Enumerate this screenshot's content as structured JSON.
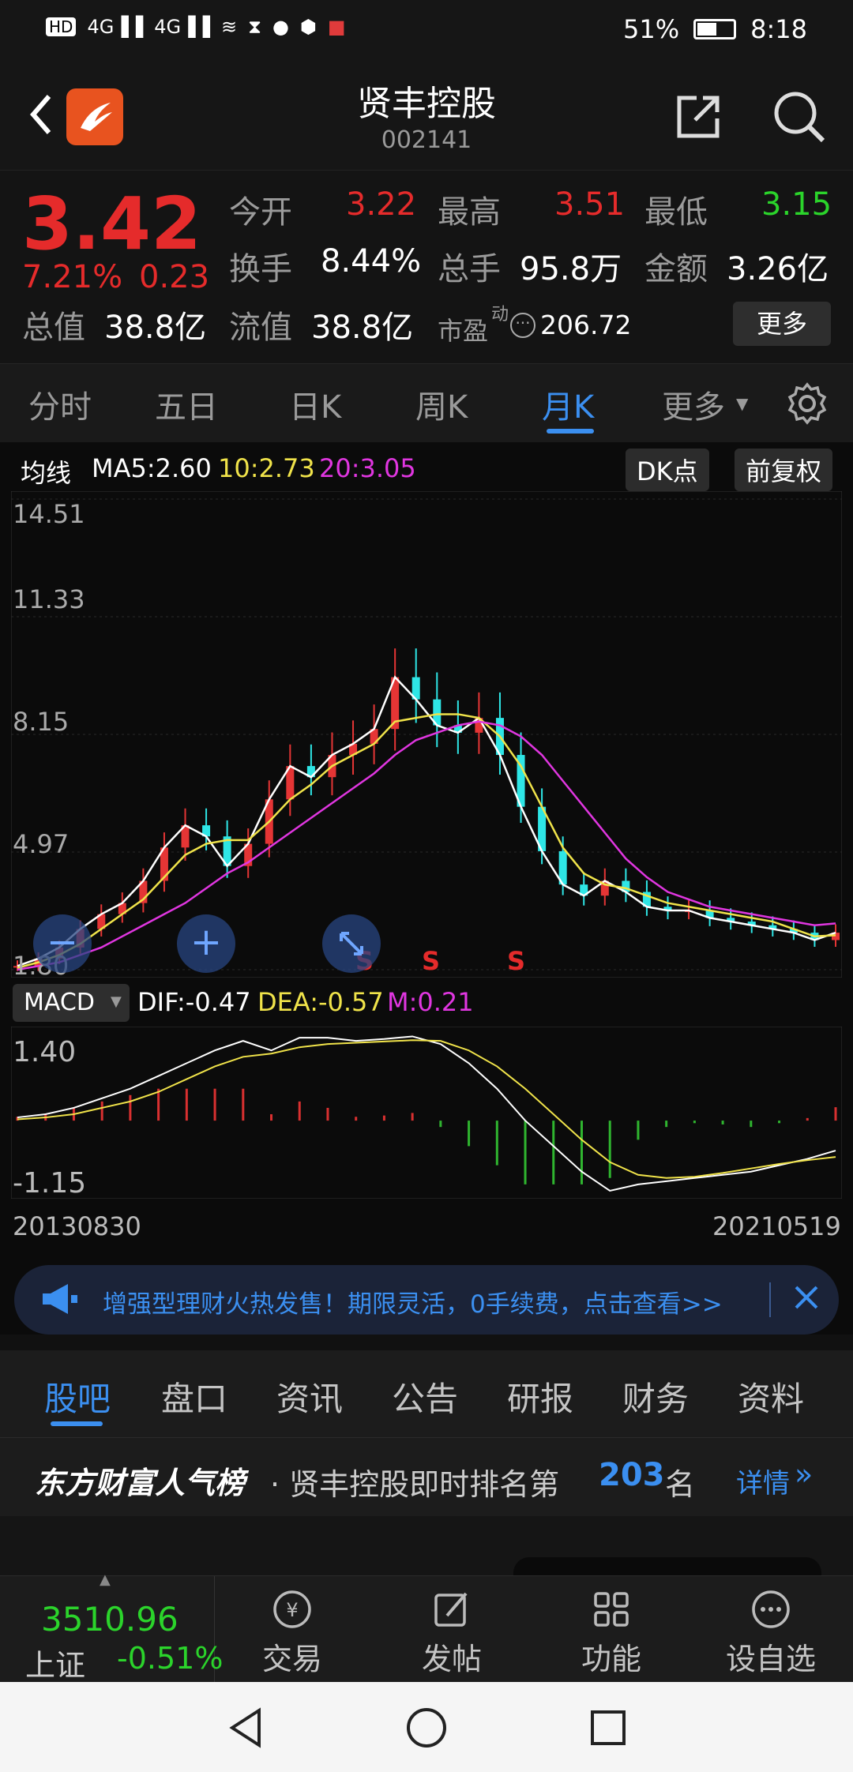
{
  "status_bar": {
    "left_icons": [
      "HD",
      "4G",
      "4G",
      "wifi",
      "hourglass",
      "qq",
      "shield",
      "app"
    ],
    "battery": "51%",
    "time": "8:18"
  },
  "header": {
    "title": "贤丰控股",
    "code": "002141"
  },
  "quote": {
    "price": "3.42",
    "change_pct": "7.21%",
    "change": "0.23",
    "open_label": "今开",
    "open": "3.22",
    "high_label": "最高",
    "high": "3.51",
    "low_label": "最低",
    "low": "3.15",
    "turnover_label": "换手",
    "turnover": "8.44%",
    "volume_label": "总手",
    "volume": "95.8万",
    "amount_label": "金额",
    "amount": "3.26亿",
    "mcap_label": "总值",
    "mcap": "38.8亿",
    "float_label": "流值",
    "float_mcap": "38.8亿",
    "pe_label": "市盈",
    "pe_sup": "动",
    "pe": "206.72",
    "more": "更多"
  },
  "chart_tabs": [
    "分时",
    "五日",
    "日K",
    "周K",
    "月K",
    "更多"
  ],
  "active_tab": "月K",
  "ma_bar": {
    "label": "均线",
    "ma5": "MA5:2.60",
    "ma10": "10:2.73",
    "ma20": "20:3.05",
    "dk": "DK点",
    "fq": "前复权"
  },
  "macd_bar": {
    "label": "MACD",
    "dif": "DIF:-0.47",
    "dea": "DEA:-0.57",
    "m": "M:0.21"
  },
  "chart_data": [
    {
      "type": "line",
      "ylim": [
        1.8,
        14.51
      ],
      "y_ticks": [
        "14.51",
        "11.33",
        "8.15",
        "4.97",
        "1.80"
      ],
      "x_start": "20130830",
      "x_end": "20210519",
      "markers": [
        "S",
        "S",
        "S"
      ],
      "series": [
        {
          "name": "MA5",
          "color": "#ffffff",
          "values": [
            1.9,
            2.1,
            2.4,
            2.9,
            3.3,
            3.6,
            4.2,
            5.1,
            5.7,
            5.4,
            4.6,
            5.2,
            6.4,
            7.3,
            7.0,
            7.6,
            7.9,
            8.3,
            9.7,
            9.1,
            8.4,
            8.2,
            8.6,
            7.6,
            6.2,
            5.0,
            4.1,
            3.8,
            4.2,
            3.9,
            3.5,
            3.4,
            3.4,
            3.2,
            3.1,
            3.0,
            2.9,
            2.8,
            2.6,
            2.8
          ]
        },
        {
          "name": "10",
          "color": "#f0e34a",
          "values": [
            1.85,
            2.0,
            2.2,
            2.5,
            2.9,
            3.3,
            3.7,
            4.3,
            4.9,
            5.2,
            5.3,
            5.3,
            5.8,
            6.4,
            6.8,
            7.3,
            7.6,
            7.9,
            8.5,
            8.6,
            8.7,
            8.7,
            8.6,
            8.1,
            7.3,
            6.2,
            5.1,
            4.4,
            4.1,
            4.0,
            3.8,
            3.6,
            3.5,
            3.4,
            3.3,
            3.2,
            3.1,
            2.9,
            2.7,
            2.73
          ]
        },
        {
          "name": "20",
          "color": "#e036e0",
          "values": [
            1.8,
            1.9,
            2.0,
            2.2,
            2.4,
            2.7,
            3.0,
            3.3,
            3.6,
            4.0,
            4.4,
            4.7,
            5.1,
            5.5,
            5.9,
            6.3,
            6.7,
            7.1,
            7.6,
            8.0,
            8.2,
            8.4,
            8.5,
            8.4,
            8.1,
            7.6,
            6.9,
            6.2,
            5.5,
            4.8,
            4.3,
            3.9,
            3.7,
            3.5,
            3.4,
            3.3,
            3.2,
            3.1,
            3.0,
            3.05
          ]
        }
      ]
    },
    {
      "type": "bar",
      "ylim": [
        -1.15,
        1.4
      ],
      "y_ticks": [
        "1.40",
        "-1.15"
      ],
      "series": [
        {
          "name": "DIF",
          "color": "#ffffff",
          "values": [
            0.05,
            0.1,
            0.2,
            0.35,
            0.5,
            0.7,
            0.9,
            1.1,
            1.25,
            1.1,
            1.3,
            1.3,
            1.25,
            1.28,
            1.32,
            1.2,
            0.9,
            0.5,
            0.0,
            -0.4,
            -0.8,
            -1.1,
            -1.0,
            -0.95,
            -0.9,
            -0.85,
            -0.8,
            -0.7,
            -0.6,
            -0.47
          ]
        },
        {
          "name": "DEA",
          "color": "#f0e34a",
          "values": [
            0.02,
            0.05,
            0.1,
            0.2,
            0.3,
            0.45,
            0.65,
            0.85,
            1.0,
            1.05,
            1.15,
            1.2,
            1.22,
            1.24,
            1.26,
            1.25,
            1.1,
            0.85,
            0.5,
            0.1,
            -0.3,
            -0.65,
            -0.85,
            -0.9,
            -0.88,
            -0.82,
            -0.75,
            -0.68,
            -0.62,
            -0.57
          ]
        },
        {
          "name": "M",
          "color": "#d93030",
          "values": [
            0.06,
            0.1,
            0.2,
            0.3,
            0.4,
            0.5,
            0.5,
            0.5,
            0.5,
            0.1,
            0.3,
            0.2,
            0.06,
            0.08,
            0.12,
            -0.1,
            -0.4,
            -0.7,
            -1.0,
            -1.0,
            -1.0,
            -0.9,
            -0.3,
            -0.1,
            -0.04,
            -0.06,
            -0.1,
            -0.04,
            0.04,
            0.21
          ]
        }
      ]
    }
  ],
  "ad_banner": {
    "text": "增强型理财火热发售！期限灵活，0手续费，点击查看>>"
  },
  "sub_tabs": [
    "股吧",
    "盘口",
    "资讯",
    "公告",
    "研报",
    "财务",
    "资料"
  ],
  "active_sub_tab": "股吧",
  "ranking": {
    "brand": "东方财富人气榜",
    "text": "· 贤丰控股即时排名第",
    "rank": "203",
    "unit": "名",
    "detail": "详情"
  },
  "bottom_bar": {
    "index_value": "3510.96",
    "index_name": "上证",
    "index_change": "-0.51%",
    "items": [
      "交易",
      "发帖",
      "功能",
      "设自选"
    ]
  }
}
